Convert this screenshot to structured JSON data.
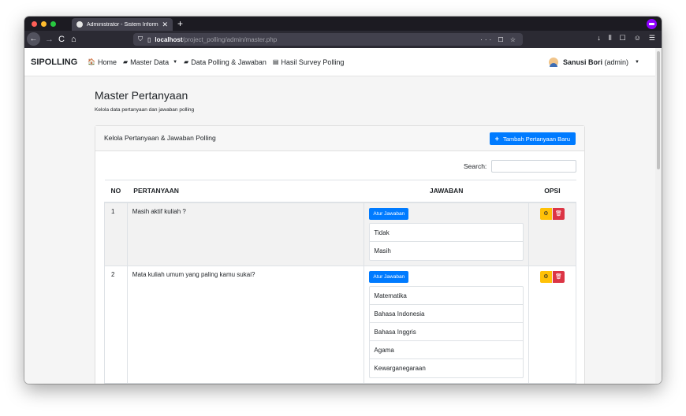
{
  "browser": {
    "tab_title": "Administrator - Sistem Informa",
    "tab_close": "✕",
    "new_tab": "+",
    "url_host": "localhost",
    "url_path": "/project_polling/admin/master.php",
    "url_actions": "··· ☐ ☆",
    "back": "←",
    "forward": "→",
    "reload": "C",
    "home": "⌂",
    "right_icons": [
      "↓",
      "⫴",
      "☐",
      "☺",
      "☰"
    ]
  },
  "navbar": {
    "brand": "SIPOLLING",
    "links": [
      {
        "icon": "🏠",
        "label": "Home",
        "caret": ""
      },
      {
        "icon": "▰",
        "label": "Master Data",
        "caret": "▼"
      },
      {
        "icon": "▰",
        "label": "Data Polling & Jawaban",
        "caret": ""
      },
      {
        "icon": "▤",
        "label": "Hasil Survey Polling",
        "caret": ""
      }
    ],
    "user_name": "Sanusi Bori",
    "user_role": "(admin)",
    "user_caret": "▼"
  },
  "page": {
    "title": "Master Pertanyaan",
    "subtitle": "Kelola data pertanyaan dan jawaban polling"
  },
  "card": {
    "title": "Kelola Pertanyaan & Jawaban Polling",
    "add_icon": "+",
    "add_button": "Tambah Pertanyaan Baru",
    "search_label": "Search:",
    "search_value": ""
  },
  "table": {
    "headers": [
      "NO",
      "PERTANYAAN",
      "JAWABAN",
      "OPSI"
    ],
    "atur_label": "Atur Jawaban",
    "edit_icon": "⚙",
    "delete_icon": "🗑",
    "rows": [
      {
        "no": "1",
        "question": "Masih aktif kuliah ?",
        "answers": [
          "Tidak",
          "Masih"
        ]
      },
      {
        "no": "2",
        "question": "Mata kuliah umum yang paling kamu sukai?",
        "answers": [
          "Matematika",
          "Bahasa Indonesia",
          "Bahasa Inggris",
          "Agama",
          "Kewarganegaraan"
        ]
      }
    ]
  }
}
